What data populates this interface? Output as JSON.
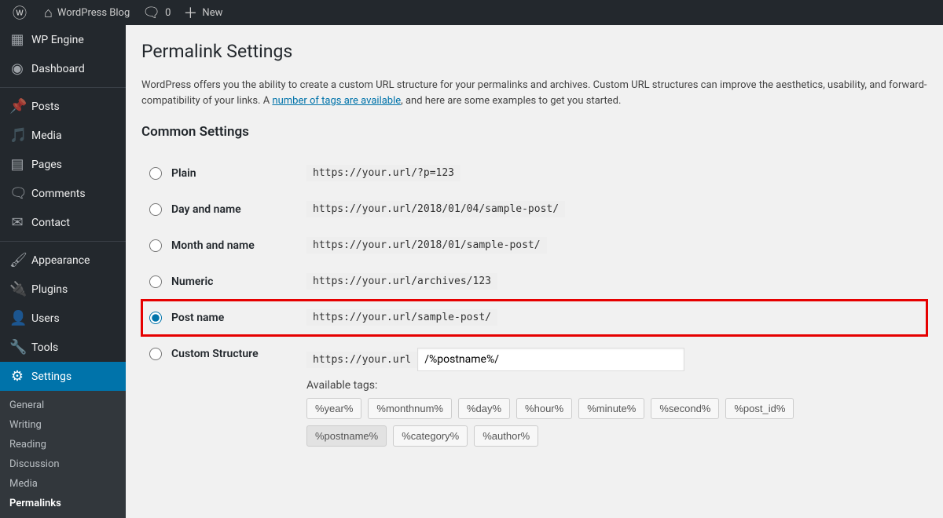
{
  "adminbar": {
    "site_title": "WordPress Blog",
    "comments_count": "0",
    "new_label": "New"
  },
  "sidebar": {
    "items": [
      {
        "label": "WP Engine",
        "icon": "wpengine"
      },
      {
        "label": "Dashboard",
        "icon": "dashboard"
      },
      {
        "label": "Posts",
        "icon": "pin",
        "sep": true
      },
      {
        "label": "Media",
        "icon": "media"
      },
      {
        "label": "Pages",
        "icon": "page"
      },
      {
        "label": "Comments",
        "icon": "comment"
      },
      {
        "label": "Contact",
        "icon": "mail"
      },
      {
        "label": "Appearance",
        "icon": "brush",
        "sep": true
      },
      {
        "label": "Plugins",
        "icon": "plug"
      },
      {
        "label": "Users",
        "icon": "user"
      },
      {
        "label": "Tools",
        "icon": "wrench"
      },
      {
        "label": "Settings",
        "icon": "sliders",
        "current": true
      }
    ],
    "submenu": [
      "General",
      "Writing",
      "Reading",
      "Discussion",
      "Media",
      "Permalinks"
    ],
    "submenu_current": "Permalinks"
  },
  "page": {
    "title": "Permalink Settings",
    "desc_pre": "WordPress offers you the ability to create a custom URL structure for your permalinks and archives. Custom URL structures can improve the aesthetics, usability, and forward-compatibility of your links. A ",
    "desc_link": "number of tags are available",
    "desc_post": ", and here are some examples to get you started.",
    "section": "Common Settings"
  },
  "options": [
    {
      "label": "Plain",
      "example": "https://your.url/?p=123",
      "checked": false
    },
    {
      "label": "Day and name",
      "example": "https://your.url/2018/01/04/sample-post/",
      "checked": false
    },
    {
      "label": "Month and name",
      "example": "https://your.url/2018/01/sample-post/",
      "checked": false
    },
    {
      "label": "Numeric",
      "example": "https://your.url/archives/123",
      "checked": false
    },
    {
      "label": "Post name",
      "example": "https://your.url/sample-post/",
      "checked": true,
      "highlight": true
    },
    {
      "label": "Custom Structure",
      "checked": false,
      "custom": true
    }
  ],
  "custom": {
    "prefix": "https://your.url",
    "value": "/%postname%/",
    "available_label": "Available tags:",
    "tags": [
      "%year%",
      "%monthnum%",
      "%day%",
      "%hour%",
      "%minute%",
      "%second%",
      "%post_id%",
      "%postname%",
      "%category%",
      "%author%"
    ],
    "active_tag": "%postname%"
  }
}
